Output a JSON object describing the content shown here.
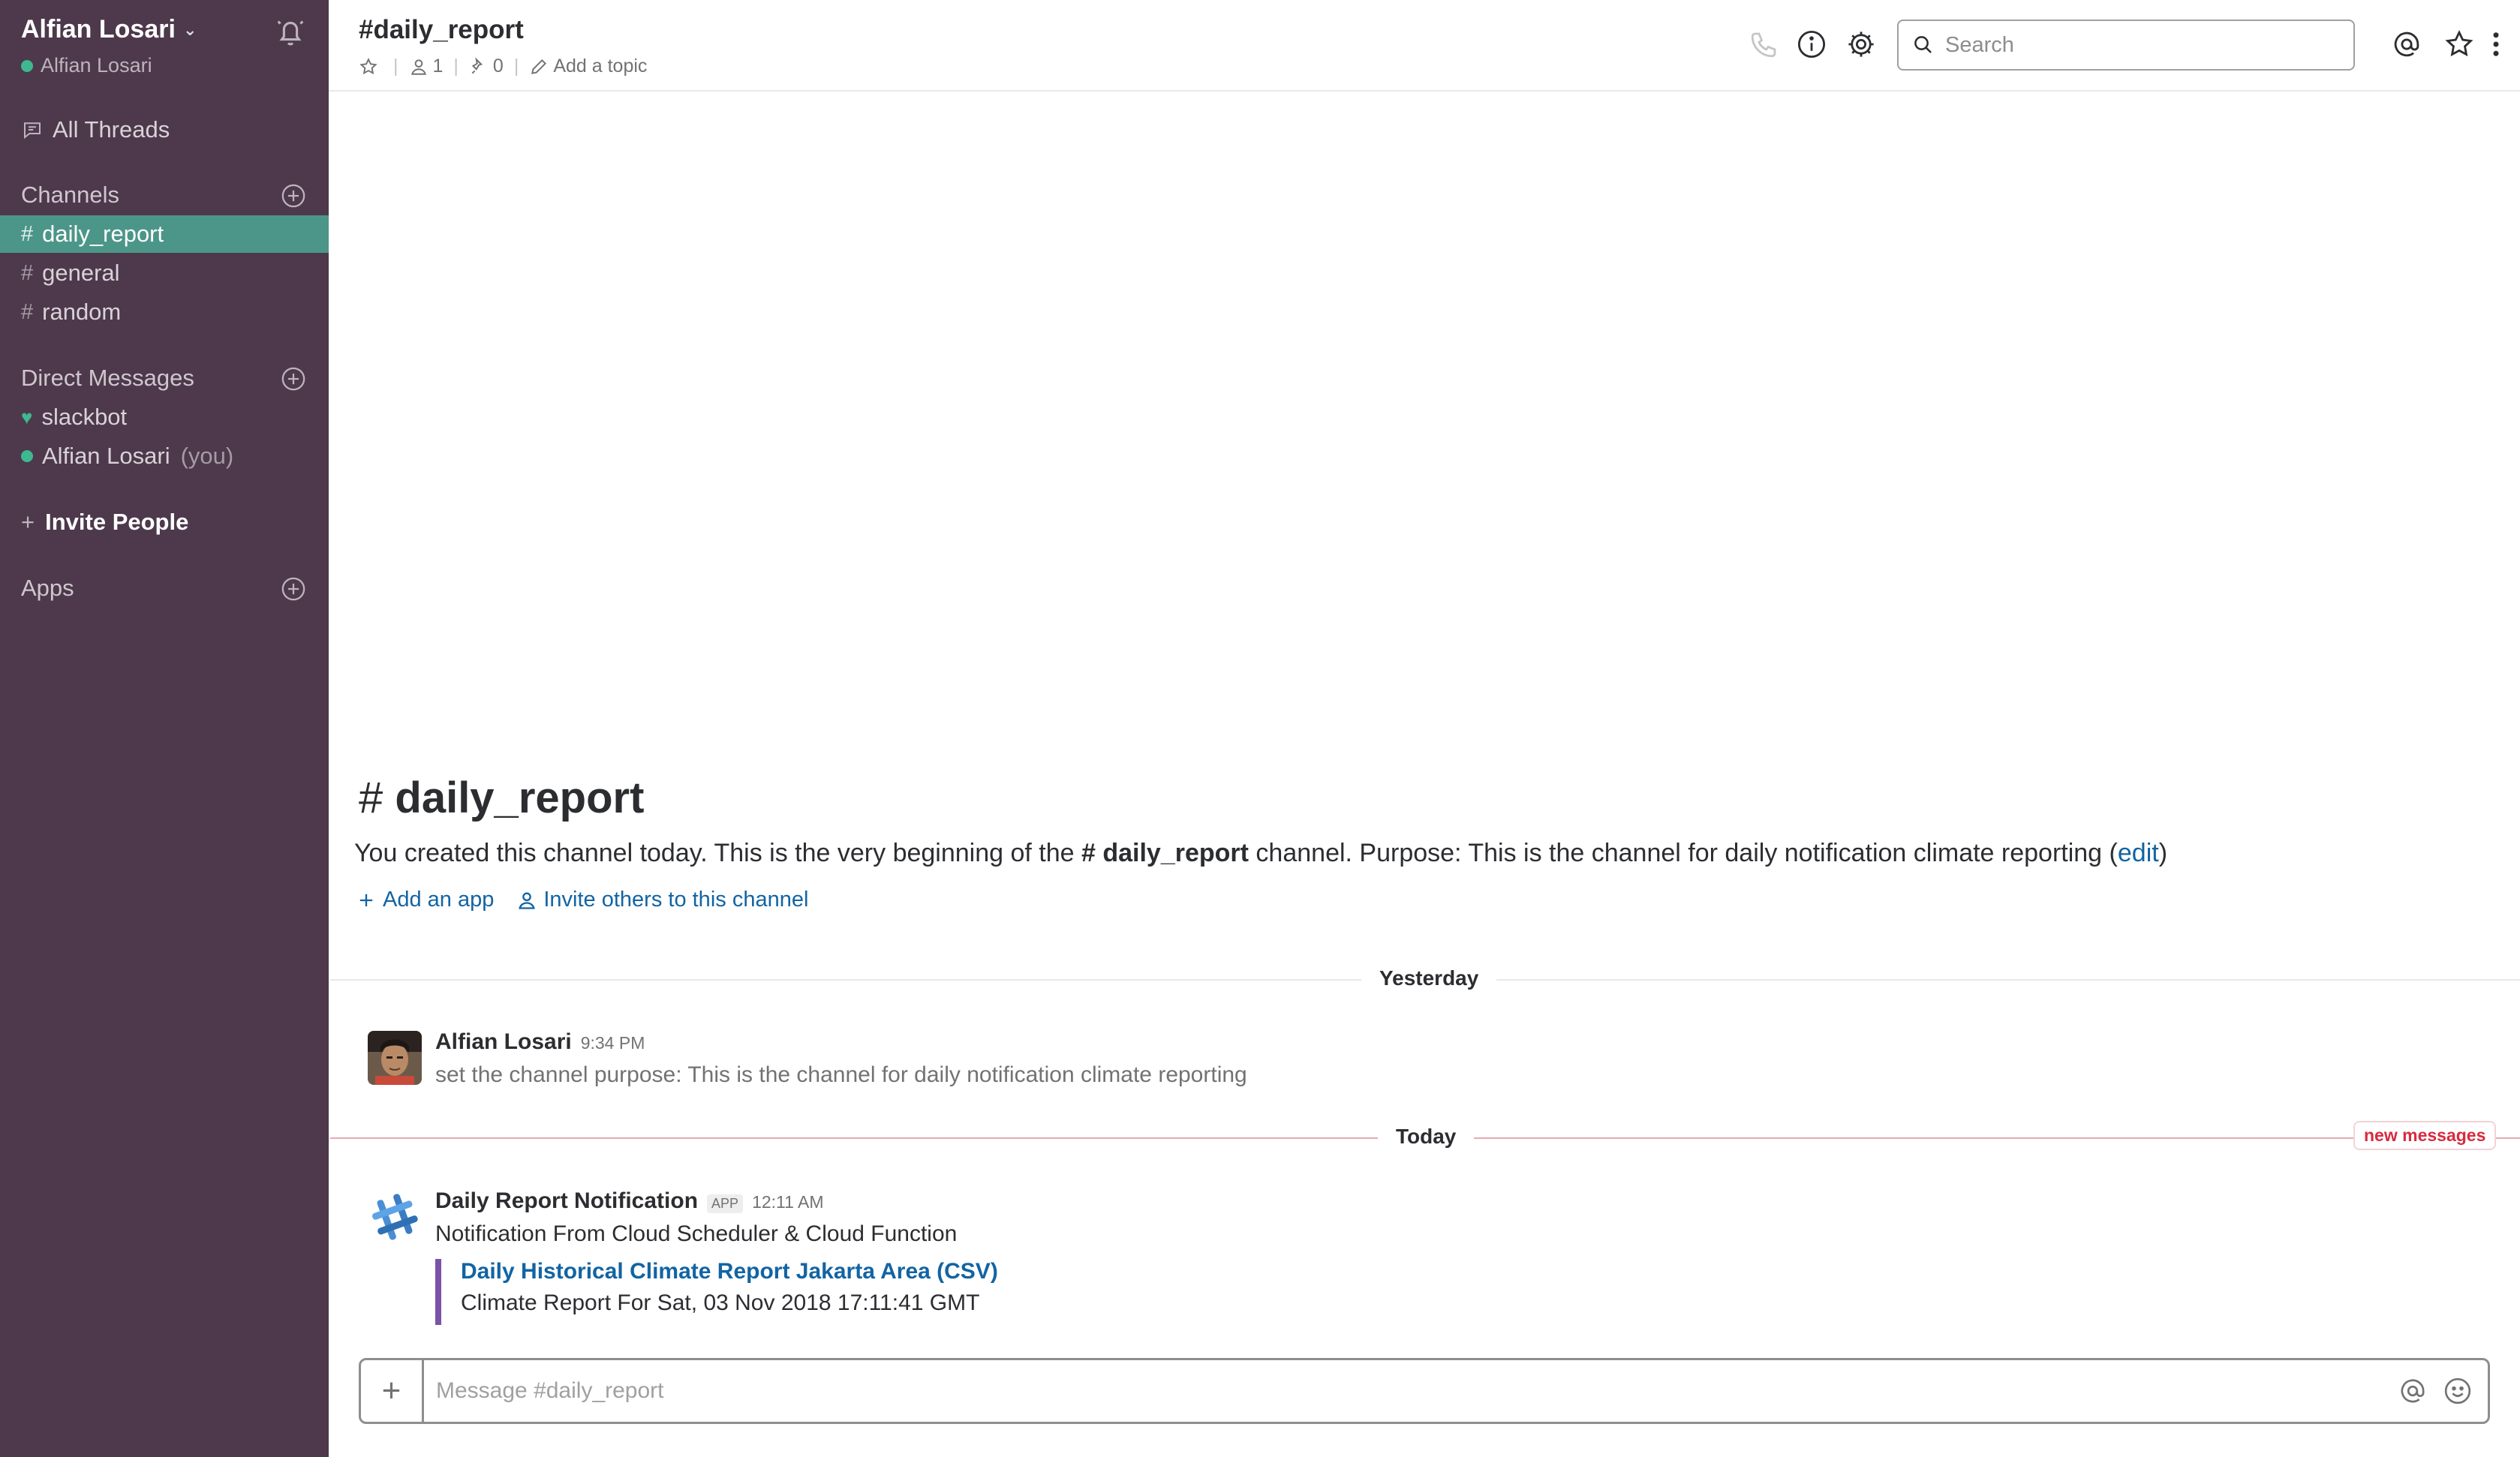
{
  "team": {
    "name": "Alfian Losari",
    "user": "Alfian Losari"
  },
  "sidebar": {
    "all_threads": "All Threads",
    "channels_heading": "Channels",
    "channels": [
      {
        "name": "daily_report",
        "active": true
      },
      {
        "name": "general",
        "active": false
      },
      {
        "name": "random",
        "active": false
      }
    ],
    "dm_heading": "Direct Messages",
    "dms": [
      {
        "name": "slackbot",
        "suffix": ""
      },
      {
        "name": "Alfian Losari",
        "suffix": "(you)"
      }
    ],
    "invite_label": "Invite People",
    "apps_heading": "Apps"
  },
  "header": {
    "channel_title": "#daily_report",
    "members_count": "1",
    "pins_count": "0",
    "add_topic": "Add a topic",
    "search_placeholder": "Search"
  },
  "intro": {
    "title_hash": "#",
    "title": "daily_report",
    "text_before": "You created this channel today. This is the very beginning of the ",
    "channel_ref": "# daily_report",
    "text_after": " channel. Purpose: This is the channel for daily notification climate reporting (",
    "edit_link": "edit",
    "text_close": ")",
    "add_app": "Add an app",
    "invite_others": "Invite others to this channel"
  },
  "dividers": {
    "yesterday": "Yesterday",
    "today": "Today",
    "new_messages": "new messages"
  },
  "messages": [
    {
      "author": "Alfian Losari",
      "time": "9:34 PM",
      "text": "set the channel purpose: This is the channel for daily notification climate reporting"
    },
    {
      "author": "Daily Report Notification",
      "badge": "APP",
      "time": "12:11 AM",
      "text": "Notification From Cloud Scheduler & Cloud Function",
      "attachment_title": "Daily Historical Climate Report Jakarta Area (CSV)",
      "attachment_text": "Climate Report For Sat, 03 Nov 2018 17:11:41 GMT",
      "attachment_color": "#7a52a6"
    }
  ],
  "composer": {
    "placeholder": "Message #daily_report"
  },
  "colors": {
    "sidebar_bg": "#4d394b",
    "active_channel": "#4c9689",
    "presence": "#3eb890",
    "link": "#1264a3",
    "new_messages": "#d72b3f"
  }
}
